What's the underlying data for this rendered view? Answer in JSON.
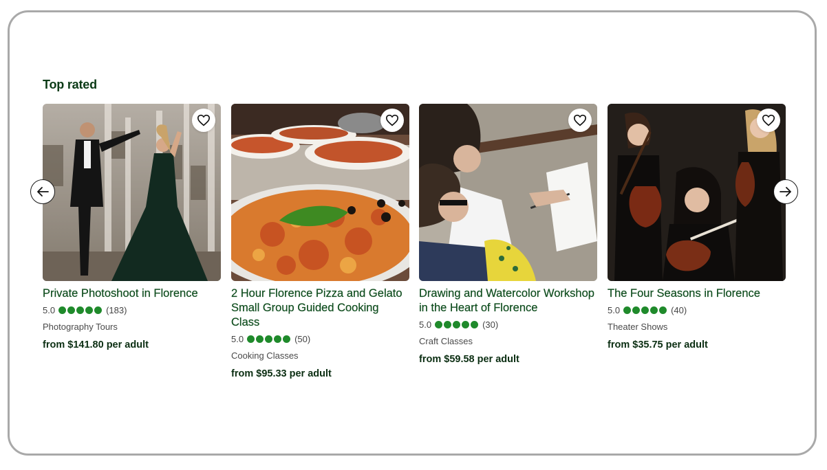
{
  "section": {
    "title": "Top rated"
  },
  "nav": {
    "prev_icon": "arrow-left-icon",
    "next_icon": "arrow-right-icon"
  },
  "colors": {
    "title_green": "#0b3a16",
    "rating_green": "#1f8a2b",
    "card_title_green": "#0f4d1e"
  },
  "cards": [
    {
      "title": "Private Photoshoot in Florence",
      "score": "5.0",
      "rating": 5,
      "reviews": "(183)",
      "category": "Photography Tours",
      "price": "from $141.80 per adult",
      "image_icon": "photoshoot-photo"
    },
    {
      "title": "2 Hour Florence Pizza and Gelato Small Group Guided Cooking Class",
      "score": "5.0",
      "rating": 5,
      "reviews": "(50)",
      "category": "Cooking Classes",
      "price": "from $95.33 per adult",
      "image_icon": "pizza-photo"
    },
    {
      "title": "Drawing and Watercolor Workshop in the Heart of Florence",
      "score": "5.0",
      "rating": 5,
      "reviews": "(30)",
      "category": "Craft Classes",
      "price": "from $59.58 per adult",
      "image_icon": "drawing-photo"
    },
    {
      "title": "The Four Seasons in Florence",
      "score": "5.0",
      "rating": 5,
      "reviews": "(40)",
      "category": "Theater Shows",
      "price": "from $35.75 per adult",
      "image_icon": "violinists-photo"
    }
  ]
}
